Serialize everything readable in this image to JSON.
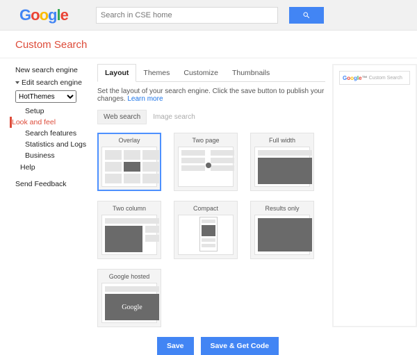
{
  "header": {
    "search_placeholder": "Search in CSE home"
  },
  "product_title": "Custom Search",
  "sidebar": {
    "new_engine": "New search engine",
    "edit_engine": "Edit search engine",
    "selected_engine": "HotThemes",
    "sub": {
      "setup": "Setup",
      "look_feel": "Look and feel",
      "search_features": "Search features",
      "stats_logs": "Statistics and Logs",
      "business": "Business"
    },
    "help": "Help",
    "feedback": "Send Feedback"
  },
  "tabs": {
    "layout": "Layout",
    "themes": "Themes",
    "customize": "Customize",
    "thumbnails": "Thumbnails"
  },
  "desc_text": "Set the layout of your search engine. Click the save button to publish your changes. ",
  "desc_link": "Learn more",
  "subtabs": {
    "web": "Web search",
    "image": "Image search"
  },
  "layouts": {
    "overlay": "Overlay",
    "two_page": "Two page",
    "full_width": "Full width",
    "two_column": "Two column",
    "compact": "Compact",
    "results_only": "Results only",
    "google_hosted": "Google hosted"
  },
  "buttons": {
    "save": "Save",
    "save_code": "Save & Get Code"
  },
  "preview": {
    "placeholder": "Custom Search"
  }
}
